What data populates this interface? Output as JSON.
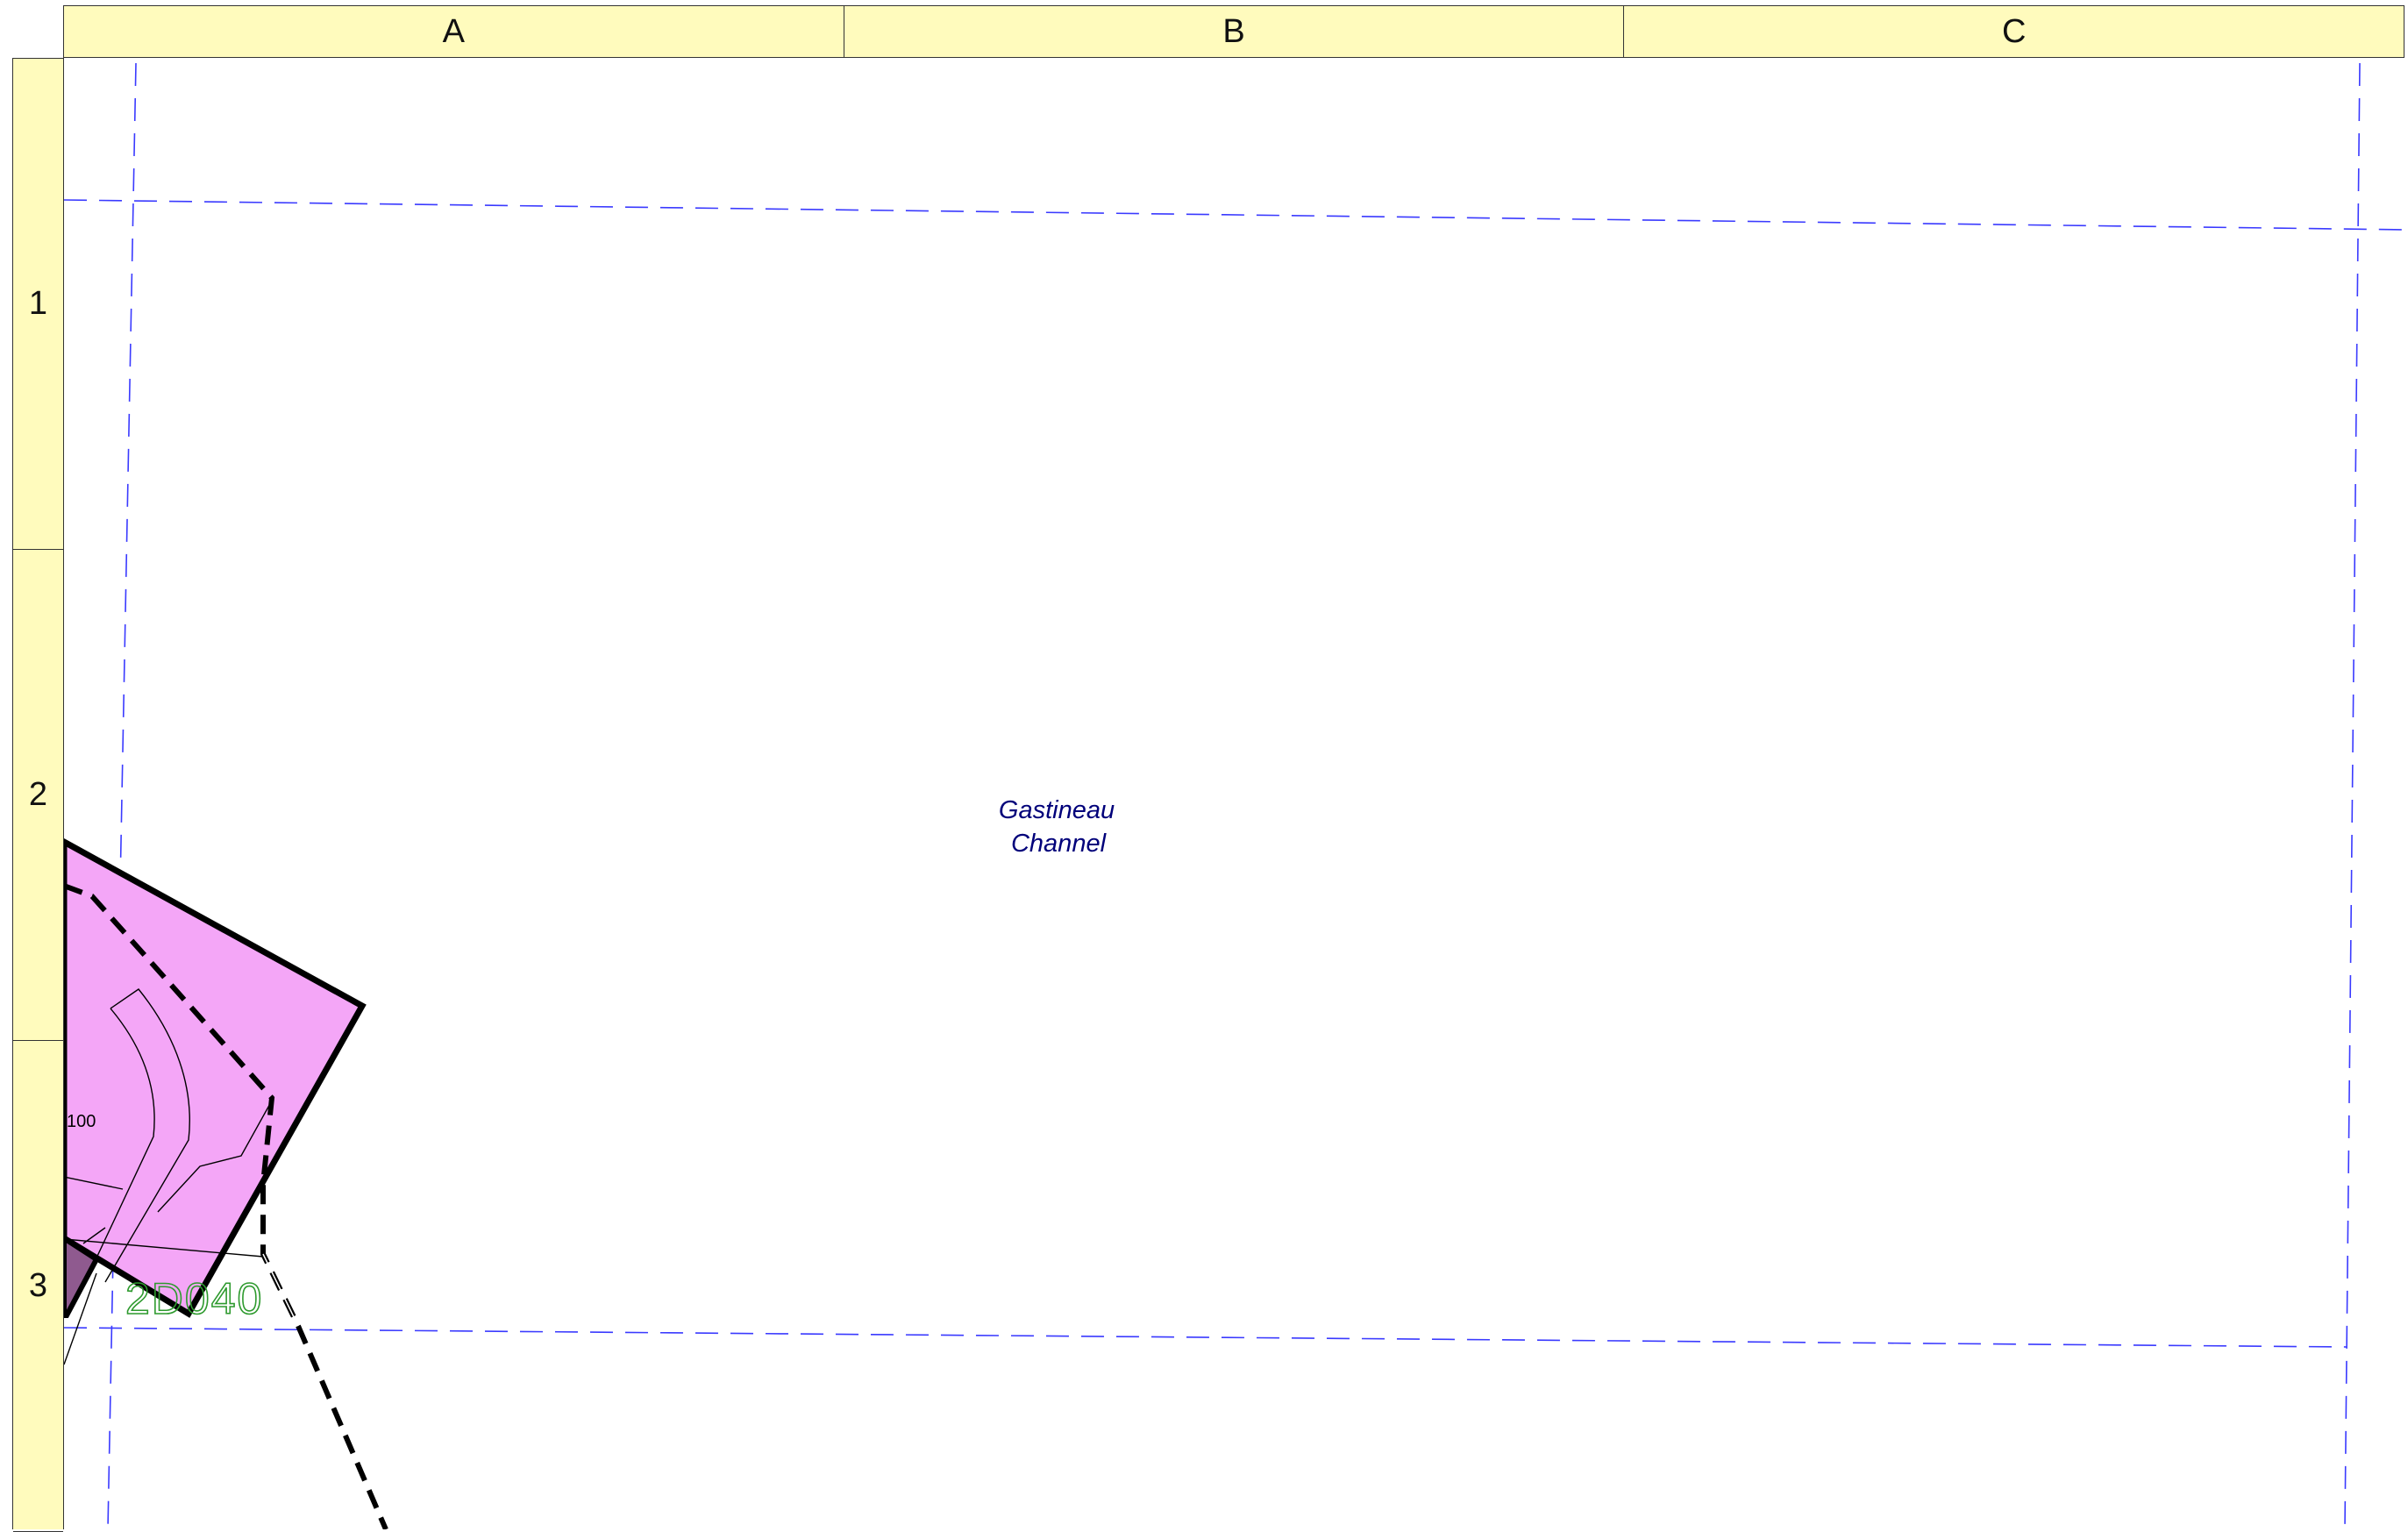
{
  "grid": {
    "columns": [
      "A",
      "B",
      "C"
    ],
    "rows": [
      "1",
      "2",
      "3"
    ]
  },
  "map": {
    "water_label_line1": "Gastineau",
    "water_label_line2": "Channel",
    "parcel_number": "100",
    "sheet_id": "2D040"
  },
  "colors": {
    "grid_band": "#fffbbd",
    "parcel_fill": "#f4a6f7",
    "dark_parcel_fill": "#8f5a8f",
    "guide_lines": "#3a3aff",
    "water_label": "#00007a",
    "sheet_id_color": "#2e9a2e"
  }
}
